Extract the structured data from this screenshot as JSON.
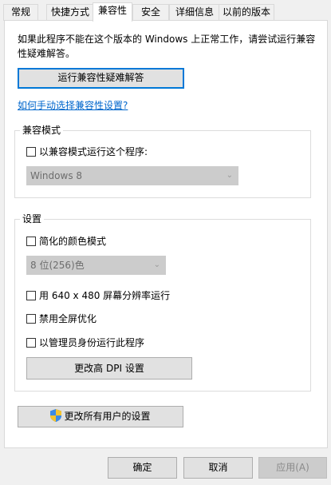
{
  "tabs": [
    "常规",
    "快捷方式",
    "兼容性",
    "安全",
    "详细信息",
    "以前的版本"
  ],
  "active_tab": "兼容性",
  "description": "如果此程序不能在这个版本的 Windows 上正常工作，请尝试运行兼容性疑难解答。",
  "troubleshoot_button": "运行兼容性疑难解答",
  "manual_link": "如何手动选择兼容性设置?",
  "compat_mode": {
    "title": "兼容模式",
    "checkbox_label": "以兼容模式运行这个程序:",
    "checked": false,
    "os_select": "Windows 8"
  },
  "settings": {
    "title": "设置",
    "reduced_color": {
      "label": "简化的颜色模式",
      "checked": false
    },
    "color_select": "8 位(256)色",
    "res_640": {
      "label": "用 640 x 480 屏幕分辨率运行",
      "checked": false
    },
    "disable_fullscreen": {
      "label": "禁用全屏优化",
      "checked": false
    },
    "run_as_admin": {
      "label": "以管理员身份运行此程序",
      "checked": false
    },
    "dpi_button": "更改高 DPI 设置"
  },
  "all_users_button": "更改所有用户的设置",
  "footer": {
    "ok": "确定",
    "cancel": "取消",
    "apply": "应用(A)"
  },
  "icons": {
    "select_chevron": "chevron-down-icon",
    "admin": "uac-shield-icon"
  },
  "colors": {
    "link": "#0066cc",
    "focus": "#0078d7",
    "button_bg": "#e1e1e1",
    "disabled_bg": "#cccccc"
  }
}
